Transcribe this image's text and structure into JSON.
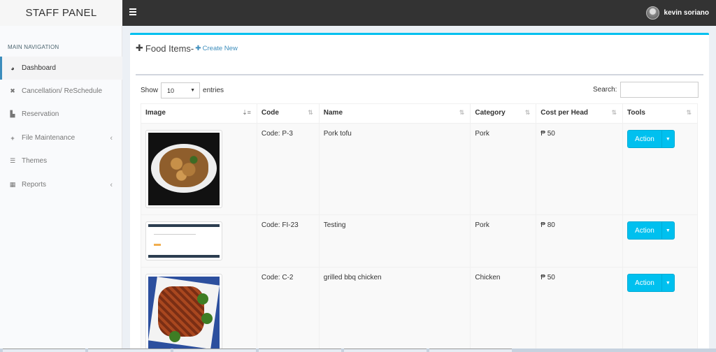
{
  "app": {
    "logo": "STAFF PANEL"
  },
  "topbar": {
    "user_name": "kevin soriano"
  },
  "sidebar": {
    "header": "MAIN NAVIGATION",
    "items": [
      {
        "label": "Dashboard",
        "icon": "dashboard-icon",
        "active": true
      },
      {
        "label": "Cancellation/ ReSchedule",
        "icon": "times-icon"
      },
      {
        "label": "Reservation",
        "icon": "cart-icon"
      },
      {
        "label": "File Maintenance",
        "icon": "plus-icon",
        "chevron": true
      },
      {
        "label": "Themes",
        "icon": "list-icon"
      },
      {
        "label": "Reports",
        "icon": "calendar-icon",
        "chevron": true
      }
    ]
  },
  "box": {
    "title": "Food Items-",
    "create_label": "Create New"
  },
  "controls": {
    "show_label": "Show",
    "entries_value": "10",
    "entries_label": "entries",
    "search_label": "Search:"
  },
  "table": {
    "headers": [
      "Image",
      "Code",
      "Name",
      "Category",
      "Cost per Head",
      "Tools"
    ],
    "rows": [
      {
        "code": "Code: P-3",
        "name": "Pork tofu",
        "category": "Pork",
        "cost": "₱ 50",
        "action": "Action"
      },
      {
        "code": "Code: FI-23",
        "name": "Testing",
        "category": "Pork",
        "cost": "₱ 80",
        "action": "Action"
      },
      {
        "code": "Code: C-2",
        "name": "grilled bbq chicken",
        "category": "Chicken",
        "cost": "₱ 50",
        "action": "Action"
      }
    ]
  },
  "colors": {
    "accent": "#00c0ef",
    "topbar": "#333333",
    "link": "#3c8dbc"
  }
}
